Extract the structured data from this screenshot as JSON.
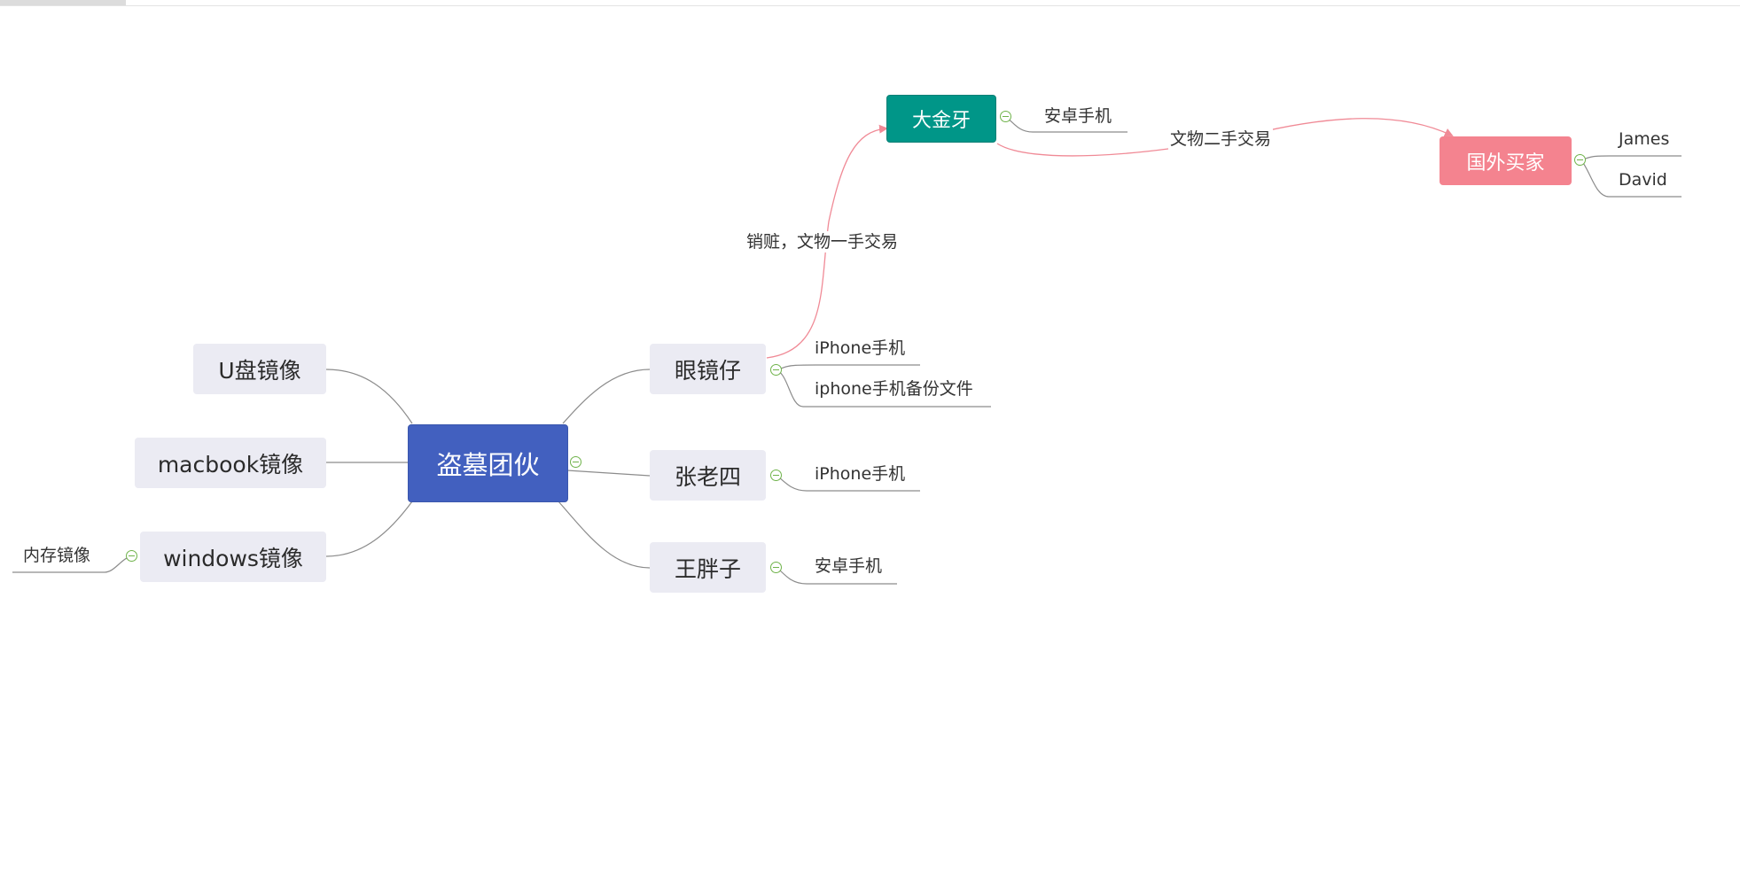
{
  "mindmap": {
    "root": {
      "label": "盗墓团伙"
    },
    "left": [
      {
        "label": "U盘镜像"
      },
      {
        "label": "macbook镜像"
      },
      {
        "label": "windows镜像",
        "children": [
          "内存镜像"
        ]
      }
    ],
    "right": [
      {
        "label": "眼镜仔",
        "children": [
          "iPhone手机",
          "iphone手机备份文件"
        ]
      },
      {
        "label": "张老四",
        "children": [
          "iPhone手机"
        ]
      },
      {
        "label": "王胖子",
        "children": [
          "安卓手机"
        ]
      }
    ],
    "dajinya": {
      "label": "大金牙",
      "children": [
        "安卓手机"
      ]
    },
    "foreign_buyer": {
      "label": "国外买家",
      "children": [
        "James",
        "David"
      ]
    },
    "relations": [
      {
        "from": "眼镜仔",
        "to": "大金牙",
        "label": "销赃，文物一手交易"
      },
      {
        "from": "大金牙",
        "to": "国外买家",
        "label": "文物二手交易"
      }
    ]
  },
  "colors": {
    "root": "#4260bf",
    "topic": "#ebebf3",
    "dajinya": "#009688",
    "foreign_buyer": "#f4838f",
    "relation_line": "#f08a96",
    "branch_line": "#8c8c8c",
    "collapse_button": "#6fb34a"
  }
}
